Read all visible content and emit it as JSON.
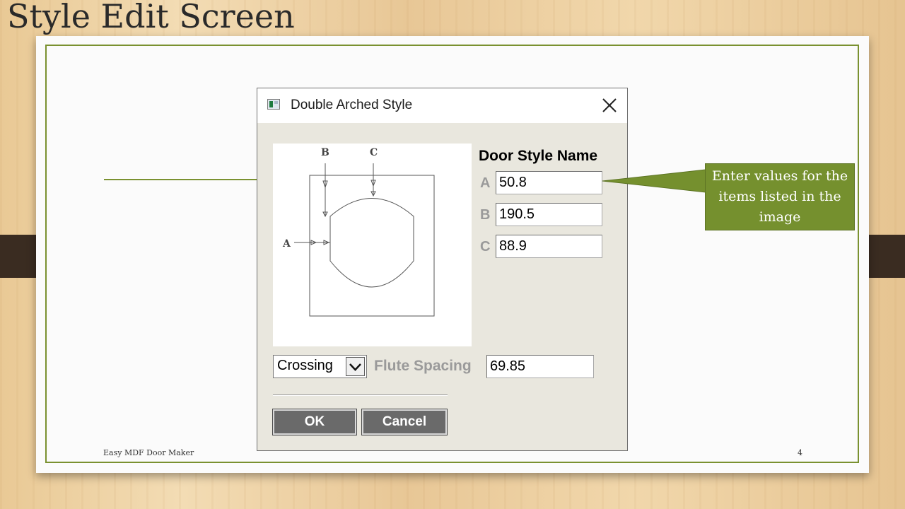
{
  "slide": {
    "title": "Style Edit Screen",
    "footer_left": "Easy MDF Door Maker",
    "footer_right": "4"
  },
  "dialog": {
    "title": "Double Arched Style",
    "heading": "Door Style Name",
    "fields": [
      {
        "label": "A",
        "value": "50.8"
      },
      {
        "label": "B",
        "value": "190.5"
      },
      {
        "label": "C",
        "value": "88.9"
      }
    ],
    "pattern_selected": "Crossing",
    "spacing_label": "Flute Spacing",
    "spacing_value": "69.85",
    "ok_label": "OK",
    "cancel_label": "Cancel",
    "diagram_labels": {
      "a": "A",
      "b": "B",
      "c": "C"
    }
  },
  "callout": {
    "text": "Enter values for the items listed in the image",
    "color": "#75902e"
  },
  "icons": [
    "app-icon",
    "close-icon",
    "chevron-down-icon"
  ]
}
